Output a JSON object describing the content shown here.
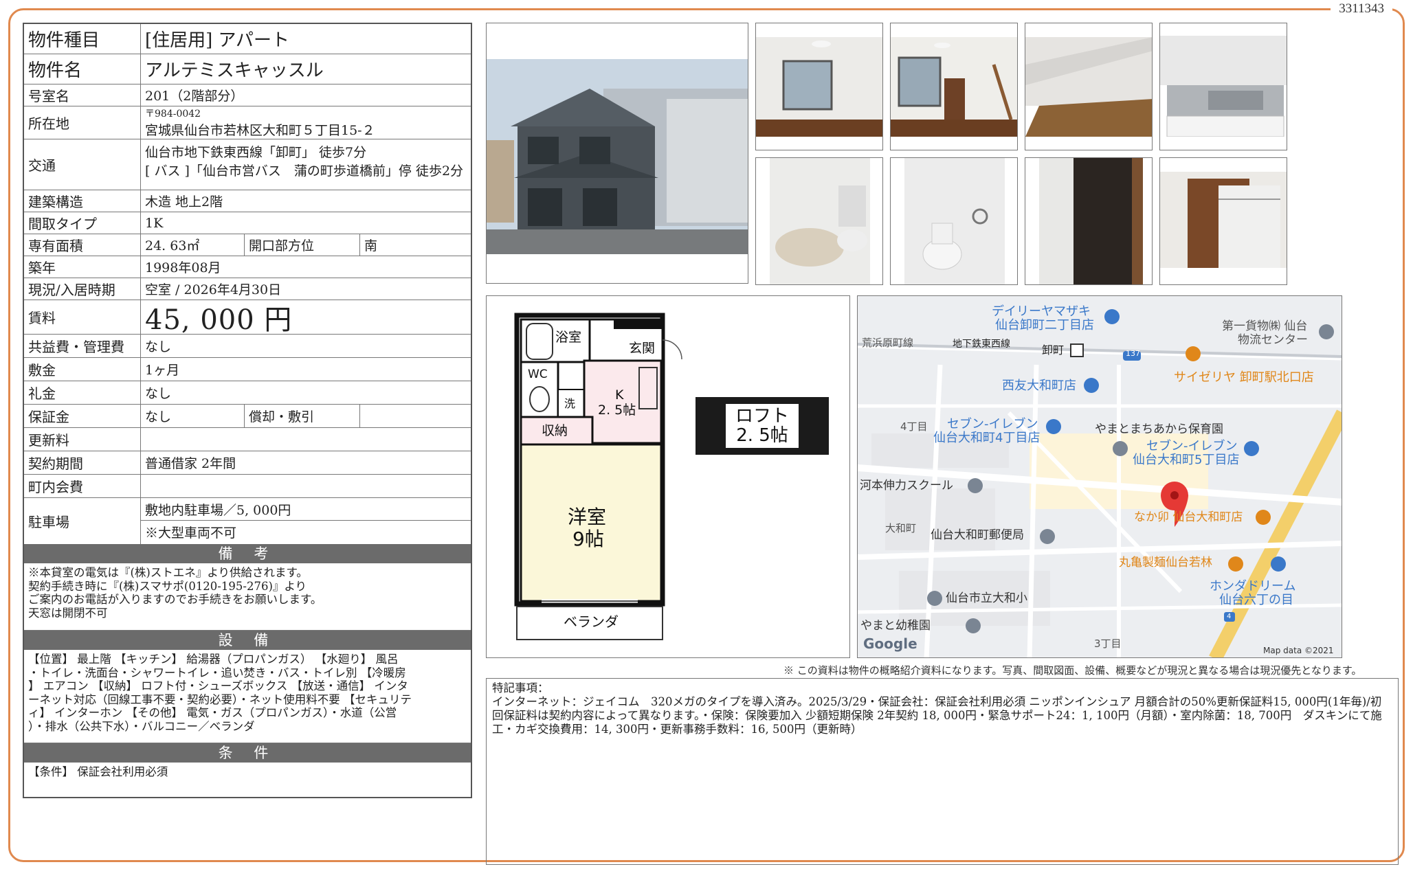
{
  "doc_id": "3311343",
  "property": {
    "type_label": "物件種目",
    "type_value": "[住居用]  アパート",
    "name_label": "物件名",
    "name_value": "アルテミスキャッスル",
    "room_label": "号室名",
    "room_value": "201（2階部分）",
    "address_label": "所在地",
    "postal": "〒984-0042",
    "address": "宮城県仙台市若林区大和町５丁目15-２",
    "transport_label": "交通",
    "transport_1": "仙台市地下鉄東西線「卸町」 徒歩7分",
    "transport_2": "[ バス ]「仙台市営バス　蒲の町歩道橋前」停 徒歩2分",
    "structure_label": "建築構造",
    "structure_value": "木造 地上2階",
    "layout_label": "間取タイプ",
    "layout_value": "1K",
    "area_label": "専有面積",
    "area_value": "24. 63㎡",
    "orientation_label": "開口部方位",
    "orientation_value": "南",
    "built_label": "築年",
    "built_value": "1998年08月",
    "status_label": "現況/入居時期",
    "status_value": "空室 /  2026年4月30日",
    "rent_label": "賃料",
    "rent_value": "45, 000 円",
    "fee_label": "共益費・管理費",
    "fee_value": "なし",
    "deposit_label": "敷金",
    "deposit_value": "1ヶ月",
    "key_money_label": "礼金",
    "key_money_value": "なし",
    "guarantee_label": "保証金",
    "guarantee_value": "なし",
    "amortize_label": "償却・敷引",
    "amortize_value": "",
    "renewal_label": "更新料",
    "renewal_value": "",
    "contract_label": "契約期間",
    "contract_value": "普通借家 2年間",
    "community_label": "町内会費",
    "community_value": "",
    "parking_label": "駐車場",
    "parking_1": "敷地内駐車場／5, 000円",
    "parking_2": "※大型車両不可"
  },
  "remarks": {
    "title": "備 考",
    "lines": [
      "※本貸室の電気は『(株)ストエネ』より供給されます。",
      "契約手続き時に『(株)スマサポ(0120-195-276)』より",
      "ご案内のお電話が入りますのでお手続きをお願いします。",
      "天窓は開閉不可"
    ]
  },
  "facilities": {
    "title": "設 備",
    "lines": [
      "【位置】 最上階 【キッチン】 給湯器（プロパンガス） 【水廻り】 風呂",
      "・トイレ・洗面台・シャワートイレ・追い焚き・バス・トイレ別 【冷暖房",
      "】 エアコン 【収納】 ロフト付・シューズボックス 【放送・通信】 インタ",
      "ーネット対応（回線工事不要・契約必要）・ネット使用料不要 【セキュリテ",
      "ィ】 インターホン 【その他】 電気・ガス（プロパンガス）・水道（公営",
      "）・排水（公共下水）・バルコニー／ベランダ"
    ]
  },
  "conditions": {
    "title": "条 件",
    "text": "【条件】 保証会社利用必須"
  },
  "floorplan": {
    "bath": "浴室",
    "entrance": "玄関",
    "wc": "WC",
    "wash": "洗",
    "kitchen": "K",
    "kitchen_size": "2. 5帖",
    "storage": "収納",
    "room": "洋室",
    "room_size": "9帖",
    "veranda": "ベランダ",
    "loft": "ロフト",
    "loft_size": "2. 5帖"
  },
  "map": {
    "labels": [
      "デイリーヤマザキ",
      "仙台卸町二丁目店",
      "第一貨物㈱ 仙台",
      "物流センター",
      "荒浜原町線",
      "地下鉄東西線",
      "卸町",
      "137",
      "サイゼリヤ 卸町駅北口店",
      "西友大和町店",
      "4丁目",
      "セブン-イレブン",
      "仙台大和町4丁目店",
      "やまとまちあから保育園",
      "セブン-イレブン",
      "仙台大和町5丁目店",
      "河本伸力スクール",
      "なか卯 仙台大和町店",
      "大和町",
      "仙台大和町郵便局",
      "丸亀製麺仙台若林",
      "ホンダドリーム",
      "仙台六丁の目",
      "仙台市立大和小",
      "やまと幼稚園",
      "3丁目",
      "4",
      "Google",
      "Map data ©2021"
    ]
  },
  "disclaimer": "※ この資料は物件の概略紹介資料になります。写真、間取図面、設備、概要などが現況と異なる場合は現況優先となります。",
  "notes": {
    "title": "特記事項：",
    "text": "インターネット：ジェイコム　320メガのタイプを導入済み。2025/3/29・保証会社：保証会社利用必須 ニッポンインシュア 月額合計の50%更新保証料15, 000円(1年毎)/初回保証料は契約内容によって異なります。・保険：保険要加入 少額短期保険 2年契約 18, 000円・緊急サポート24：1, 100円（月額）・室内除菌：18, 700円　ダスキンにて施工・カギ交換費用：14, 300円・更新事務手数料：16, 500円（更新時）"
  },
  "colors": {
    "frame": "#e0894e",
    "section_header": "#6b6b6b",
    "map_pin": "#e53935"
  }
}
